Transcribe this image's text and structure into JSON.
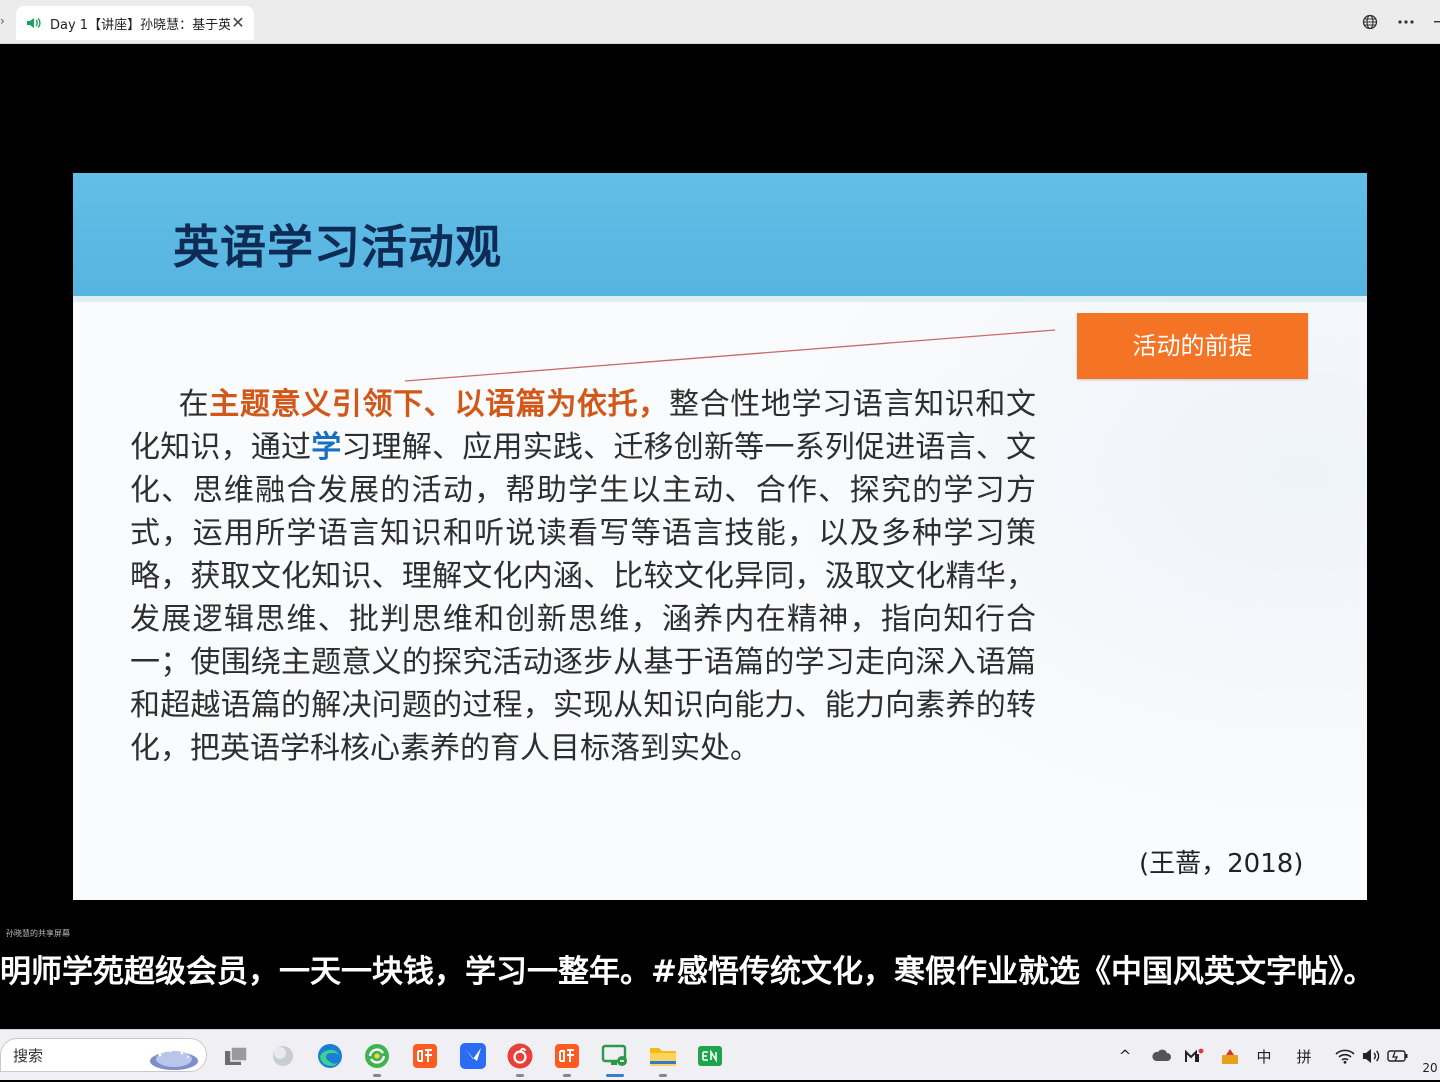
{
  "browser": {
    "tab": {
      "title": "Day 1【讲座】孙晓慧：基于英",
      "close_glyph": "✕"
    }
  },
  "slide": {
    "title": "英语学习活动观",
    "premise_label": "活动的前提",
    "body": {
      "lead": "在",
      "highlight": "主题意义引领下、以语篇为依托，",
      "text_a": "整合性地学习语言知识和文化知识，通过",
      "text_blue": "学",
      "text_b": "习理解、应用实践、迁移创新等一系列促进语言、文化、思维融合发展的活动，帮助学生以主动、合作、探究的学习方式，运用所学语言知识和听说读看写等语言技能，以及多种学习策略，获取文化知识、理解文化内涵、比较文化异同，汲取文化精华，发展逻辑思维、批判思维和创新思维，涵养内在精神，指向知行合一；使围绕主题意义的探究活动逐步从基于语篇的学习走向深入语篇和超越语篇的解决问题的过程，实现从知识向能力、能力向素养的转化，把英语学科核心素养的育人目标落到实处。"
    },
    "citation": "(王蔷，2018)"
  },
  "share_label": "孙晓慧的共享屏幕",
  "marquee_text": "明师学苑超级会员，一天一块钱，学习一整年。#感悟传统文化，寒假作业就选《中国风英文字帖》。",
  "taskbar": {
    "search_placeholder": "搜索",
    "apps": [
      "task-view",
      "cortana",
      "edge",
      "browser-360",
      "ting-app",
      "feishu",
      "netease-music",
      "ting-app-2",
      "meeting-app",
      "file-explorer",
      "en-app"
    ],
    "tray": {
      "chevron": "^",
      "ime_zh": "中",
      "ime_pinyin": "拼",
      "clock_frag": "20"
    }
  },
  "colors": {
    "header_blue": "#5ab8e3",
    "title_navy": "#0d2b55",
    "premise_orange": "#f47324",
    "highlight_orange": "#d2581a",
    "highlight_blue": "#1a6fc2"
  }
}
